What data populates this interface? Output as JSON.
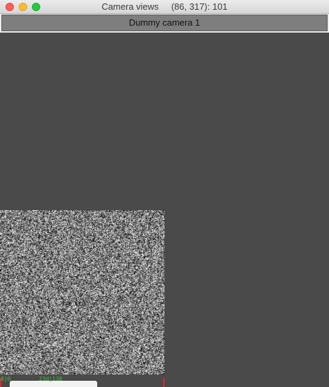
{
  "window": {
    "title": "Camera views     (86, 317): 101",
    "buttons": [
      "close",
      "minimize",
      "zoom"
    ]
  },
  "tabs": [
    {
      "label": "Dummy camera 1",
      "active": true
    }
  ],
  "camera_view": {
    "image": "random-noise",
    "status": {
      "left_value": "0|0",
      "center_value": "23d|138"
    }
  },
  "colors": {
    "background": "#4a4a4a",
    "tab_active": "#7e7e7e",
    "status_text": "#3ec23e",
    "marker": "#e02828"
  }
}
